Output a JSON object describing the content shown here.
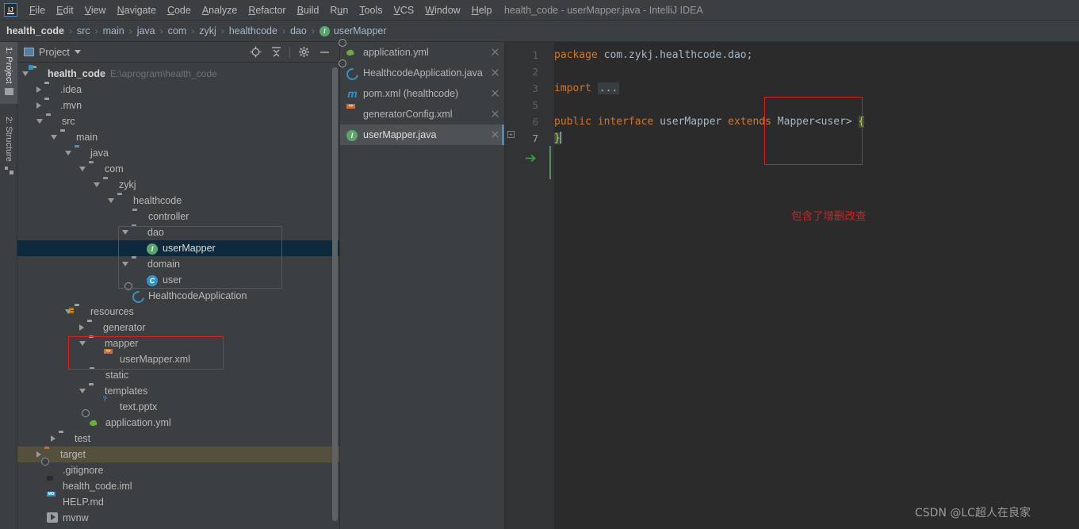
{
  "window": {
    "title": "health_code - userMapper.java - IntelliJ IDEA",
    "logo": "IJ"
  },
  "menubar": {
    "items": [
      {
        "label": "File",
        "mnemonic": "F"
      },
      {
        "label": "Edit",
        "mnemonic": "E"
      },
      {
        "label": "View",
        "mnemonic": "V"
      },
      {
        "label": "Navigate",
        "mnemonic": "N"
      },
      {
        "label": "Code",
        "mnemonic": "C"
      },
      {
        "label": "Analyze",
        "mnemonic": "A"
      },
      {
        "label": "Refactor",
        "mnemonic": "R"
      },
      {
        "label": "Build",
        "mnemonic": "B"
      },
      {
        "label": "Run",
        "mnemonic": "u"
      },
      {
        "label": "Tools",
        "mnemonic": "T"
      },
      {
        "label": "VCS",
        "mnemonic": "V"
      },
      {
        "label": "Window",
        "mnemonic": "W"
      },
      {
        "label": "Help",
        "mnemonic": "H"
      }
    ]
  },
  "breadcrumb": {
    "items": [
      "health_code",
      "src",
      "main",
      "java",
      "com",
      "zykj",
      "healthcode",
      "dao",
      "userMapper"
    ],
    "last_icon": "I"
  },
  "toolstrip": {
    "tabs": [
      {
        "label": "1: Project",
        "icon": "project-folder-icon",
        "active": true
      },
      {
        "label": "2: Structure",
        "icon": "structure-blocks-icon",
        "active": false
      }
    ]
  },
  "project_panel": {
    "title": "Project",
    "tools": [
      "locate-target-icon",
      "collapse-all-icon",
      "settings-gear-icon",
      "minimize-icon"
    ],
    "tree": [
      {
        "depth": 0,
        "twisty": "down",
        "icon": "module",
        "label": "health_code",
        "bold": true,
        "path": "E:\\aprogram\\health_code"
      },
      {
        "depth": 1,
        "twisty": "right",
        "icon": "folder",
        "label": ".idea"
      },
      {
        "depth": 1,
        "twisty": "right",
        "icon": "folder",
        "label": ".mvn"
      },
      {
        "depth": 1,
        "twisty": "down",
        "icon": "folder",
        "label": "src"
      },
      {
        "depth": 2,
        "twisty": "down",
        "icon": "folder",
        "label": "main"
      },
      {
        "depth": 3,
        "twisty": "down",
        "icon": "folder-blue",
        "label": "java"
      },
      {
        "depth": 4,
        "twisty": "down",
        "icon": "package",
        "label": "com"
      },
      {
        "depth": 5,
        "twisty": "down",
        "icon": "package",
        "label": "zykj"
      },
      {
        "depth": 6,
        "twisty": "down",
        "icon": "package",
        "label": "healthcode"
      },
      {
        "depth": 7,
        "twisty": "none",
        "icon": "package",
        "label": "controller"
      },
      {
        "depth": 7,
        "twisty": "down",
        "icon": "package",
        "label": "dao"
      },
      {
        "depth": 8,
        "twisty": "none",
        "icon": "interface",
        "label": "userMapper",
        "selected": true
      },
      {
        "depth": 7,
        "twisty": "down",
        "icon": "package",
        "label": "domain"
      },
      {
        "depth": 8,
        "twisty": "none",
        "icon": "class",
        "label": "user"
      },
      {
        "depth": 7,
        "twisty": "none",
        "icon": "spring-blue",
        "label": "HealthcodeApplication"
      },
      {
        "depth": 3,
        "twisty": "down",
        "icon": "folder-res",
        "label": "resources"
      },
      {
        "depth": 4,
        "twisty": "right",
        "icon": "folder",
        "label": "generator"
      },
      {
        "depth": 4,
        "twisty": "down",
        "icon": "folder",
        "label": "mapper"
      },
      {
        "depth": 5,
        "twisty": "none",
        "icon": "xml-file",
        "label": "userMapper.xml"
      },
      {
        "depth": 4,
        "twisty": "none",
        "icon": "folder",
        "label": "static"
      },
      {
        "depth": 4,
        "twisty": "down",
        "icon": "folder",
        "label": "templates"
      },
      {
        "depth": 5,
        "twisty": "none",
        "icon": "pptx-file",
        "label": "text.pptx"
      },
      {
        "depth": 4,
        "twisty": "none",
        "icon": "spring-green",
        "label": "application.yml"
      },
      {
        "depth": 2,
        "twisty": "right",
        "icon": "folder",
        "label": "test"
      },
      {
        "depth": 1,
        "twisty": "right",
        "icon": "folder-orange",
        "label": "target",
        "target_hl": true
      },
      {
        "depth": 1,
        "twisty": "none",
        "icon": "gitignore",
        "label": ".gitignore"
      },
      {
        "depth": 1,
        "twisty": "none",
        "icon": "iml-file",
        "label": "health_code.iml"
      },
      {
        "depth": 1,
        "twisty": "none",
        "icon": "md-file",
        "label": "HELP.md"
      },
      {
        "depth": 1,
        "twisty": "none",
        "icon": "run-script",
        "label": "mvnw"
      }
    ]
  },
  "editor_tabs": [
    {
      "label": "application.yml",
      "icon": "spring-green",
      "active": false
    },
    {
      "label": "HealthcodeApplication.java",
      "icon": "spring-blue",
      "active": false
    },
    {
      "label": "pom.xml (healthcode)",
      "icon": "maven-m",
      "active": false
    },
    {
      "label": "generatorConfig.xml",
      "icon": "xml-file",
      "active": false
    },
    {
      "label": "userMapper.java",
      "icon": "interface",
      "active": true
    }
  ],
  "editor": {
    "gutter_lines": [
      "1",
      "2",
      "3",
      "5",
      "6",
      "7"
    ],
    "run_marker_line": "6",
    "lines": [
      {
        "n": "1",
        "tokens": [
          {
            "t": "package ",
            "c": "kw"
          },
          {
            "t": "com.zykj.healthcode.dao;",
            "c": "pl"
          }
        ]
      },
      {
        "n": "2",
        "tokens": []
      },
      {
        "n": "3",
        "tokens": [
          {
            "t": "import ",
            "c": "kw"
          },
          {
            "t": "...",
            "c": "ellipsis"
          }
        ]
      },
      {
        "n": "5",
        "tokens": []
      },
      {
        "n": "6",
        "tokens": [
          {
            "t": "public ",
            "c": "kw"
          },
          {
            "t": "interface ",
            "c": "kw"
          },
          {
            "t": "userMapper ",
            "c": "pl"
          },
          {
            "t": "extends ",
            "c": "kw"
          },
          {
            "t": "Mapper<user> ",
            "c": "pl"
          },
          {
            "t": "{",
            "c": "brace"
          }
        ]
      },
      {
        "n": "7",
        "tokens": [
          {
            "t": "}",
            "c": "brace"
          }
        ]
      }
    ]
  },
  "annotations": {
    "code_note": "包含了增删改查",
    "watermark": "CSDN @LC超人在良家",
    "accent_red": "#e21b1b",
    "selection_blue": "#0d293e",
    "target_highlight": "#54503c"
  }
}
